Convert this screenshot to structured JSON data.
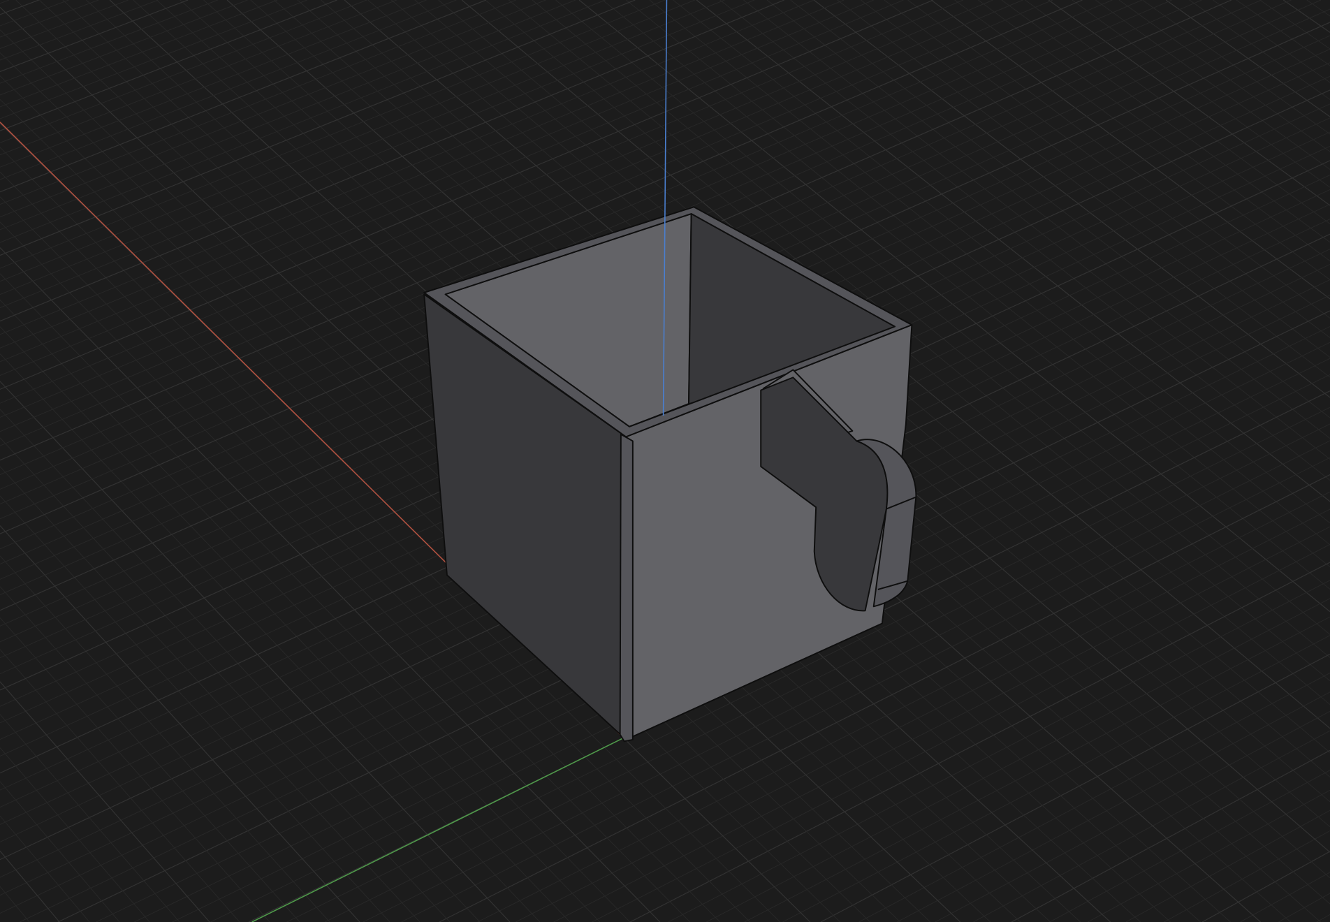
{
  "viewport": {
    "background_color": "#1c1c1c",
    "grid_minor_color": "#282828",
    "grid_major_color": "#323232"
  },
  "axes": {
    "x_color": "#b0503f",
    "y_color": "#4f9a4a",
    "z_color": "#4a7fd0"
  },
  "model": {
    "name": "square-mug",
    "face_light": "#636367",
    "face_mid": "#55555a",
    "face_dark": "#38383b",
    "edge_color": "#0e0e0e"
  }
}
